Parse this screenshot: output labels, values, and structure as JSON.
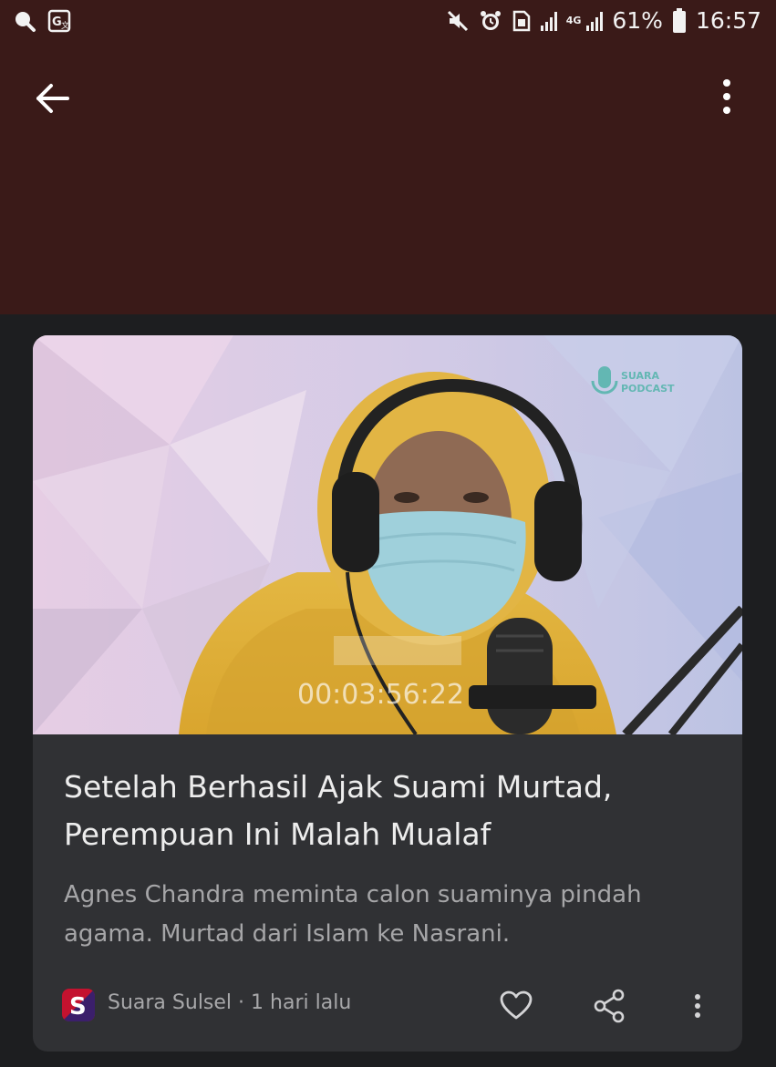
{
  "status_bar": {
    "battery": "61%",
    "time": "16:57",
    "network": "4G",
    "icons": [
      "search-icon",
      "translate-icon",
      "mute-icon",
      "alarm-icon",
      "sim-icon",
      "signal-icon",
      "battery-icon"
    ]
  },
  "toolbar": {
    "back_icon": "arrow-left-icon",
    "menu_icon": "more-vert-icon"
  },
  "article": {
    "headline": "Setelah Berhasil Ajak Suami Murtad, Perempuan Ini Malah Mualaf",
    "snippet": "Agnes Chandra meminta calon suaminya pindah agama. Murtad dari Islam ke Nasrani.",
    "source": "Suara Sulsel",
    "separator": "·",
    "time_ago": "1 hari lalu",
    "source_logo_letter": "S",
    "image": {
      "timecode": "00:03:56:22",
      "watermark": "PODCAST"
    }
  },
  "colors": {
    "header_bg": "#3a1a18",
    "page_bg": "#1d1e20",
    "card_bg": "#303134",
    "headline_text": "#ededed",
    "snippet_text": "#a6a6a8",
    "source_logo_bg": "#c4122f"
  }
}
